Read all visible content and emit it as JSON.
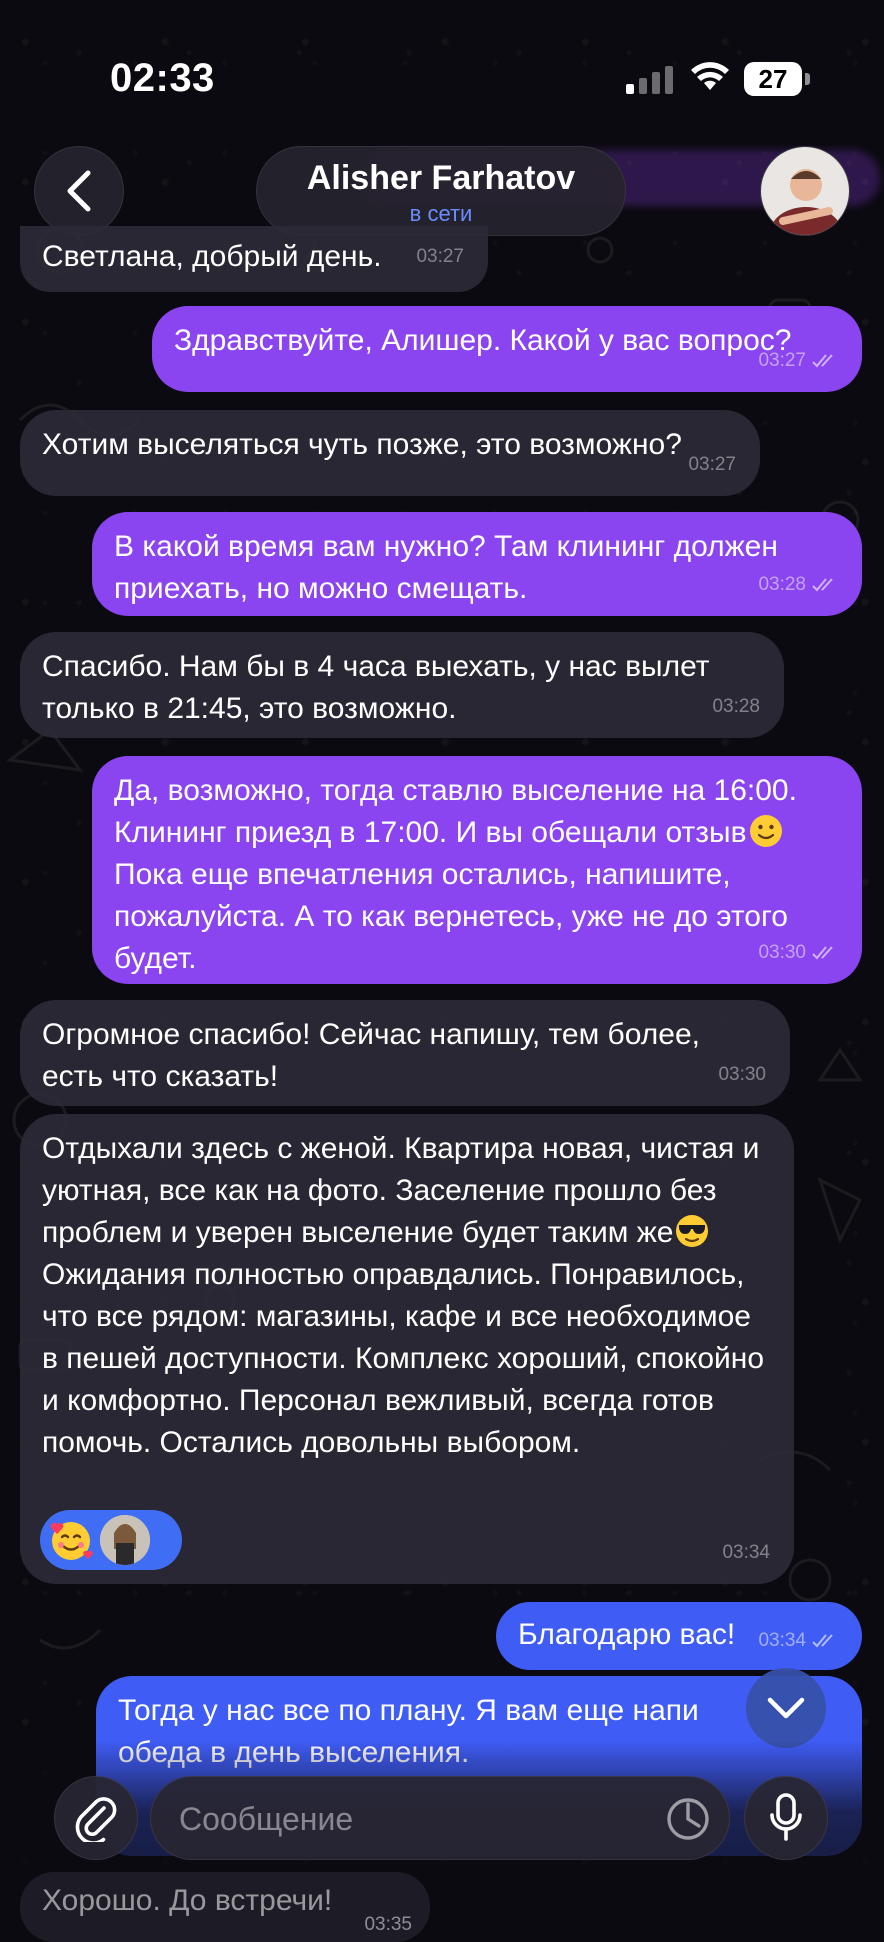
{
  "status_bar": {
    "time": "02:33",
    "battery": "27"
  },
  "header": {
    "contact_name": "Alisher Farhatov",
    "contact_status": "в сети",
    "back_icon": "chevron-left-icon",
    "avatar_icon": "contact-avatar"
  },
  "messages": [
    {
      "direction": "in",
      "text": "Светлана, добрый день.",
      "time": "03:27"
    },
    {
      "direction": "out",
      "text": "Здравствуйте, Алишер. Какой у вас вопрос?",
      "time": "03:27",
      "read": true
    },
    {
      "direction": "in",
      "text": "Хотим выселяться чуть позже, это возможно?",
      "time": "03:27"
    },
    {
      "direction": "out",
      "text": "В какой время вам нужно? Там клининг должен приехать, но можно смещать.",
      "time": "03:28",
      "read": true
    },
    {
      "direction": "in",
      "text": "Спасибо. Нам бы в 4 часа выехать, у нас вылет только в 21:45, это возможно.",
      "time": "03:28"
    },
    {
      "direction": "out",
      "text_before_emoji": "Да, возможно, тогда ставлю выселение на 16:00. Клининг приезд в 17:00. И вы обещали отзыв",
      "emoji": "slightly-smiling-face",
      "text_after_emoji": " Пока еще впечатления остались, напишите, пожалуйста. А то как вернетесь, уже не до этого будет.",
      "time": "03:30",
      "read": true
    },
    {
      "direction": "in",
      "text": "Огромное спасибо! Сейчас напишу, тем более, есть что сказать!",
      "time": "03:30"
    },
    {
      "direction": "in",
      "text_before_emoji": "Отдыхали здесь с женой. Квартира новая, чистая и уютная, все как на фото. Заселение прошло без проблем и уверен выселение будет таким же",
      "emoji": "smiling-face-with-sunglasses",
      "text_after_emoji": "Ожидания полностью оправдались. Понравилось, что все рядом: магазины, кафе и все необходимое в пешей доступности. Комплекс хороший, спокойно и комфортно. Персонал вежливый, всегда готов помочь. Остались довольны выбором.",
      "time": "03:34",
      "reaction": "smiling-face-with-hearts"
    },
    {
      "direction": "out",
      "text": "Благодарю вас!",
      "time": "03:34",
      "read": true
    },
    {
      "direction": "out",
      "text": "Тогда у нас все по плану. Я вам еще напи... обеда в день выселения.",
      "text_visible": "Тогда у нас все по плану. Я вам еще напи\nобеда в день выселения.",
      "read": true
    },
    {
      "direction": "in",
      "text": "Хорошо. До встречи!",
      "time": "03:35"
    }
  ],
  "composer": {
    "placeholder": "Сообщение",
    "attach_icon": "paperclip-icon",
    "sticker_icon": "sticker-clock-icon",
    "mic_icon": "microphone-icon",
    "scroll_icon": "chevron-down-icon"
  },
  "colors": {
    "outgoing_bubble": "#8b45f0",
    "outgoing_bubble_recent": "#3f5cf5",
    "incoming_bubble": "#2d2a36",
    "online_status": "#6b8cff",
    "background": "#0b0a10"
  }
}
